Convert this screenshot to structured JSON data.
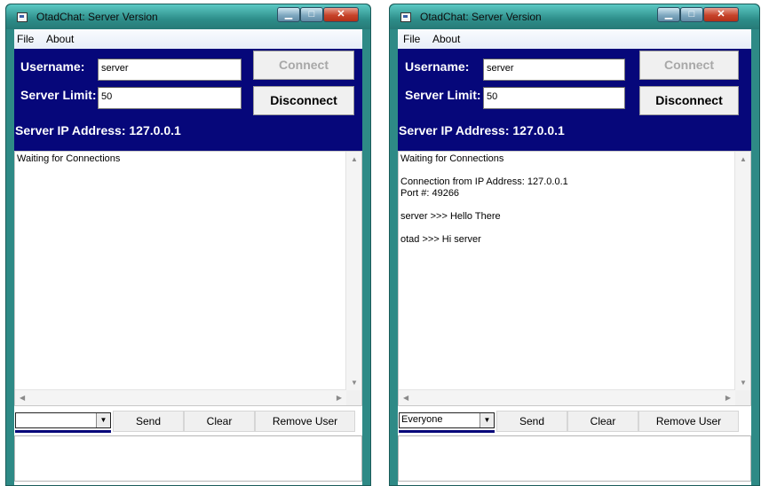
{
  "windows": [
    {
      "title": "OtadChat: Server Version",
      "menu": [
        "File",
        "About"
      ],
      "username_label": "Username:",
      "username_value": "server",
      "server_limit_label": "Server Limit:",
      "server_limit_value": "50",
      "connect_label": "Connect",
      "disconnect_label": "Disconnect",
      "server_ip": "Server IP Address: 127.0.0.1",
      "log": "Waiting for Connections",
      "recipient": "",
      "send_label": "Send",
      "clear_label": "Clear",
      "remove_user_label": "Remove User"
    },
    {
      "title": "OtadChat: Server Version",
      "menu": [
        "File",
        "About"
      ],
      "username_label": "Username:",
      "username_value": "server",
      "server_limit_label": "Server Limit:",
      "server_limit_value": "50",
      "connect_label": "Connect",
      "disconnect_label": "Disconnect",
      "server_ip": "Server IP Address: 127.0.0.1",
      "log": "Waiting for Connections\n\nConnection from IP Address: 127.0.0.1\nPort #: 49266\n\nserver >>> Hello There\n\notad >>> Hi server",
      "recipient": "Everyone",
      "send_label": "Send",
      "clear_label": "Clear",
      "remove_user_label": "Remove User"
    }
  ],
  "colors": {
    "panel": "#06077a",
    "window_frame": "#2e8a86"
  },
  "icons": [
    "app-icon",
    "minimize-icon",
    "maximize-icon",
    "close-icon",
    "scroll-up-icon",
    "scroll-down-icon",
    "scroll-left-icon",
    "scroll-right-icon",
    "dropdown-arrow-icon"
  ]
}
